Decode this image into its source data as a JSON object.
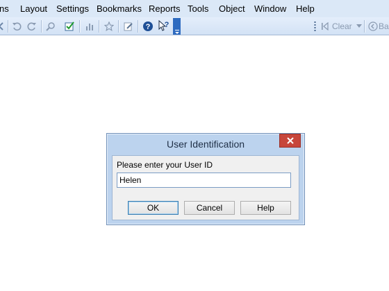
{
  "menubar": {
    "items": [
      "ns",
      "Layout",
      "Settings",
      "Bookmarks",
      "Reports",
      "Tools",
      "Object",
      "Window",
      "Help"
    ]
  },
  "toolbar": {
    "icons": [
      "back-icon",
      "undo-icon",
      "redo-icon",
      "search-icon",
      "checkbox-icon",
      "chart-icon",
      "star-icon",
      "edit-icon",
      "help-icon",
      "whats-this-icon",
      "overflow-chevron-icon",
      "clear-icon",
      "back-circle-icon"
    ],
    "clear_label": "Clear",
    "back_label": "Ba"
  },
  "dialog": {
    "title": "User Identification",
    "prompt": "Please enter your User ID",
    "user_id_value": "Helen",
    "ok_label": "OK",
    "cancel_label": "Cancel",
    "help_label": "Help",
    "close_glyph": "✕"
  },
  "colors": {
    "menubar_bg": "#dbe8f7",
    "toolbar_bg": "#d3e2f5",
    "dialog_frame": "#bcd3ee",
    "close_button": "#c7463b",
    "overflow_button": "#2e6bc0"
  }
}
